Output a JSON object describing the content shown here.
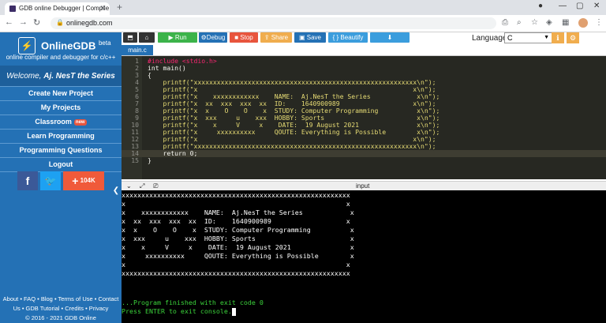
{
  "browser": {
    "tab_title": "GDB online Debugger | Compile",
    "url": "onlinegdb.com"
  },
  "sidebar": {
    "brand": "OnlineGDB",
    "brand_sup": "beta",
    "tagline": "online compiler and debugger for c/c++",
    "welcome_prefix": "Welcome, ",
    "welcome_name": "Aj. NesT the Series",
    "menu": [
      {
        "label": "Create New Project"
      },
      {
        "label": "My Projects"
      },
      {
        "label": "Classroom",
        "badge": "new"
      },
      {
        "label": "Learn Programming"
      },
      {
        "label": "Programming Questions"
      },
      {
        "label": "Logout"
      }
    ],
    "share_count": "104K",
    "footer_lines": [
      "About • FAQ • Blog • Terms of Use • Contact",
      "Us • GDB Tutorial • Credits • Privacy",
      "© 2016 - 2021 GDB Online"
    ]
  },
  "toolbar": {
    "run": "Run",
    "debug": "Debug",
    "stop": "Stop",
    "share": "Share",
    "save": "Save",
    "beautify": "{ } Beautify",
    "language_label": "Language",
    "language_value": "C"
  },
  "editor": {
    "file_tab": "main.c",
    "lines": [
      {
        "n": "1",
        "text": "#include <stdio.h>",
        "cls": "pp"
      },
      {
        "n": "2",
        "text": "int main()",
        "cls": "plain"
      },
      {
        "n": "3",
        "text": "{",
        "cls": "plain"
      },
      {
        "n": "4",
        "text": "    printf(\"xxxxxxxxxxxxxxxxxxxxxxxxxxxxxxxxxxxxxxxxxxxxxxxxxxxxxxxxxx\\n\");",
        "cls": "str"
      },
      {
        "n": "5",
        "text": "    printf(\"x                                                        x\\n\");",
        "cls": "str"
      },
      {
        "n": "6",
        "text": "    printf(\"x    xxxxxxxxxxxx    NAME:  Aj.NesT the Series            x\\n\");",
        "cls": "str"
      },
      {
        "n": "7",
        "text": "    printf(\"x  xx  xxx  xxx  xx  ID:    1640900989                   x\\n\");",
        "cls": "str"
      },
      {
        "n": "8",
        "text": "    printf(\"x  x    O    O    x  STUDY: Computer Programming          x\\n\");",
        "cls": "str"
      },
      {
        "n": "9",
        "text": "    printf(\"x  xxx     u    xxx  HOBBY: Sports                        x\\n\");",
        "cls": "str"
      },
      {
        "n": "10",
        "text": "    printf(\"x    x     V     x    DATE:  19 August 2021               x\\n\");",
        "cls": "str"
      },
      {
        "n": "11",
        "text": "    printf(\"x     xxxxxxxxxx     QOUTE: Everything is Possible        x\\n\");",
        "cls": "str"
      },
      {
        "n": "12",
        "text": "    printf(\"x                                                        x\\n\");",
        "cls": "str"
      },
      {
        "n": "13",
        "text": "    printf(\"xxxxxxxxxxxxxxxxxxxxxxxxxxxxxxxxxxxxxxxxxxxxxxxxxxxxxxxxxx\\n\");",
        "cls": "str"
      },
      {
        "n": "14",
        "text": "    return 0;",
        "cls": "plain"
      },
      {
        "n": "15",
        "text": "}",
        "cls": "plain"
      }
    ]
  },
  "console": {
    "label": "input",
    "lines": [
      "xxxxxxxxxxxxxxxxxxxxxxxxxxxxxxxxxxxxxxxxxxxxxxxxxxxxxxxxxx",
      "x                                                        x",
      "x    xxxxxxxxxxxx    NAME:  Aj.NesT the Series            x",
      "x  xx  xxx  xxx  xx  ID:    1640900989                   x",
      "x  x    O    O    x  STUDY: Computer Programming          x",
      "x  xxx     u    xxx  HOBBY: Sports                        x",
      "x    x     V     x    DATE:  19 August 2021               x",
      "x     xxxxxxxxxx     QOUTE: Everything is Possible        x",
      "x                                                        x",
      "xxxxxxxxxxxxxxxxxxxxxxxxxxxxxxxxxxxxxxxxxxxxxxxxxxxxxxxxxx"
    ],
    "finished": "...Program finished with exit code 0",
    "press_enter": "Press ENTER to exit console."
  }
}
